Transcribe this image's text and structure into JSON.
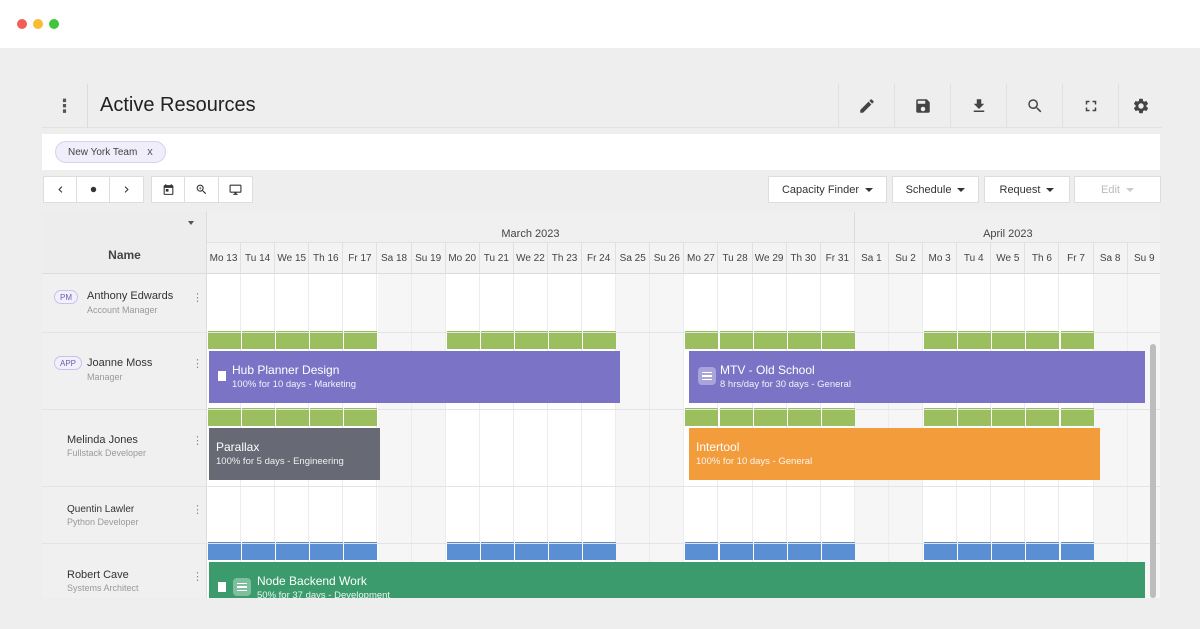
{
  "window": {
    "title": "Active Resources"
  },
  "toolbar_icons": [
    "edit-icon",
    "save-icon",
    "download-icon",
    "search-icon",
    "fullscreen-icon",
    "settings-icon"
  ],
  "filter": {
    "chip_label": "New York Team",
    "chip_close": "x"
  },
  "nav": {
    "buttons": [
      "chevron-left-icon",
      "today-dot-icon",
      "chevron-right-icon",
      "calendar-icon",
      "zoom-in-icon",
      "monitor-icon"
    ]
  },
  "actions": {
    "capacity_finder": "Capacity Finder",
    "schedule": "Schedule",
    "request": "Request",
    "edit": "Edit"
  },
  "grid": {
    "name_header": "Name",
    "months": [
      {
        "label": "March 2023",
        "days": 19
      },
      {
        "label": "April 2023",
        "days": 9
      }
    ],
    "days": [
      {
        "label": "Mo 13",
        "weekend": false
      },
      {
        "label": "Tu 14",
        "weekend": false
      },
      {
        "label": "We 15",
        "weekend": false
      },
      {
        "label": "Th 16",
        "weekend": false
      },
      {
        "label": "Fr 17",
        "weekend": false
      },
      {
        "label": "Sa 18",
        "weekend": true
      },
      {
        "label": "Su 19",
        "weekend": true
      },
      {
        "label": "Mo 20",
        "weekend": false
      },
      {
        "label": "Tu 21",
        "weekend": false
      },
      {
        "label": "We 22",
        "weekend": false
      },
      {
        "label": "Th 23",
        "weekend": false
      },
      {
        "label": "Fr 24",
        "weekend": false
      },
      {
        "label": "Sa 25",
        "weekend": true
      },
      {
        "label": "Su 26",
        "weekend": true
      },
      {
        "label": "Mo 27",
        "weekend": false
      },
      {
        "label": "Tu 28",
        "weekend": false
      },
      {
        "label": "We 29",
        "weekend": false
      },
      {
        "label": "Th 30",
        "weekend": false
      },
      {
        "label": "Fr 31",
        "weekend": false
      },
      {
        "label": "Sa 1",
        "weekend": true
      },
      {
        "label": "Su 2",
        "weekend": true
      },
      {
        "label": "Mo 3",
        "weekend": false
      },
      {
        "label": "Tu 4",
        "weekend": false
      },
      {
        "label": "We 5",
        "weekend": false
      },
      {
        "label": "Th 6",
        "weekend": false
      },
      {
        "label": "Fr 7",
        "weekend": false
      },
      {
        "label": "Sa 8",
        "weekend": true
      },
      {
        "label": "Su 9",
        "weekend": true
      }
    ]
  },
  "resources": [
    {
      "badge": "PM",
      "name": "Anthony Edwards",
      "role": "Account Manager"
    },
    {
      "badge": "APP",
      "name": "Joanne Moss",
      "role": "Manager"
    },
    {
      "badge": "",
      "name": "Melinda Jones",
      "role": "Fullstack Developer"
    },
    {
      "badge": "",
      "name": "Quentin Lawler",
      "role": "Python Developer"
    },
    {
      "badge": "",
      "name": "Robert Cave",
      "role": "Systems Architect"
    }
  ],
  "bookings": [
    {
      "title": "Hub Planner Design",
      "subtitle": "100% for 10 days - Marketing",
      "color": "#7b74c6",
      "icon": "document-icon"
    },
    {
      "title": "MTV - Old School",
      "subtitle": "8 hrs/day for 30 days - General",
      "color": "#7b74c6",
      "icon": "list-icon"
    },
    {
      "title": "Parallax",
      "subtitle": "100% for 5 days - Engineering",
      "color": "#676a74",
      "icon": ""
    },
    {
      "title": "Intertool",
      "subtitle": "100% for 10 days - General",
      "color": "#f29c3c",
      "icon": ""
    },
    {
      "title": "Node Backend Work",
      "subtitle": "50% for 37 days - Development",
      "color": "#3b9b6c",
      "icon": "document-and-list-icon"
    }
  ],
  "colors": {
    "capacity_green": "#9bbe5f",
    "capacity_blue": "#5b8fd4",
    "accent": "#7b74c6"
  }
}
